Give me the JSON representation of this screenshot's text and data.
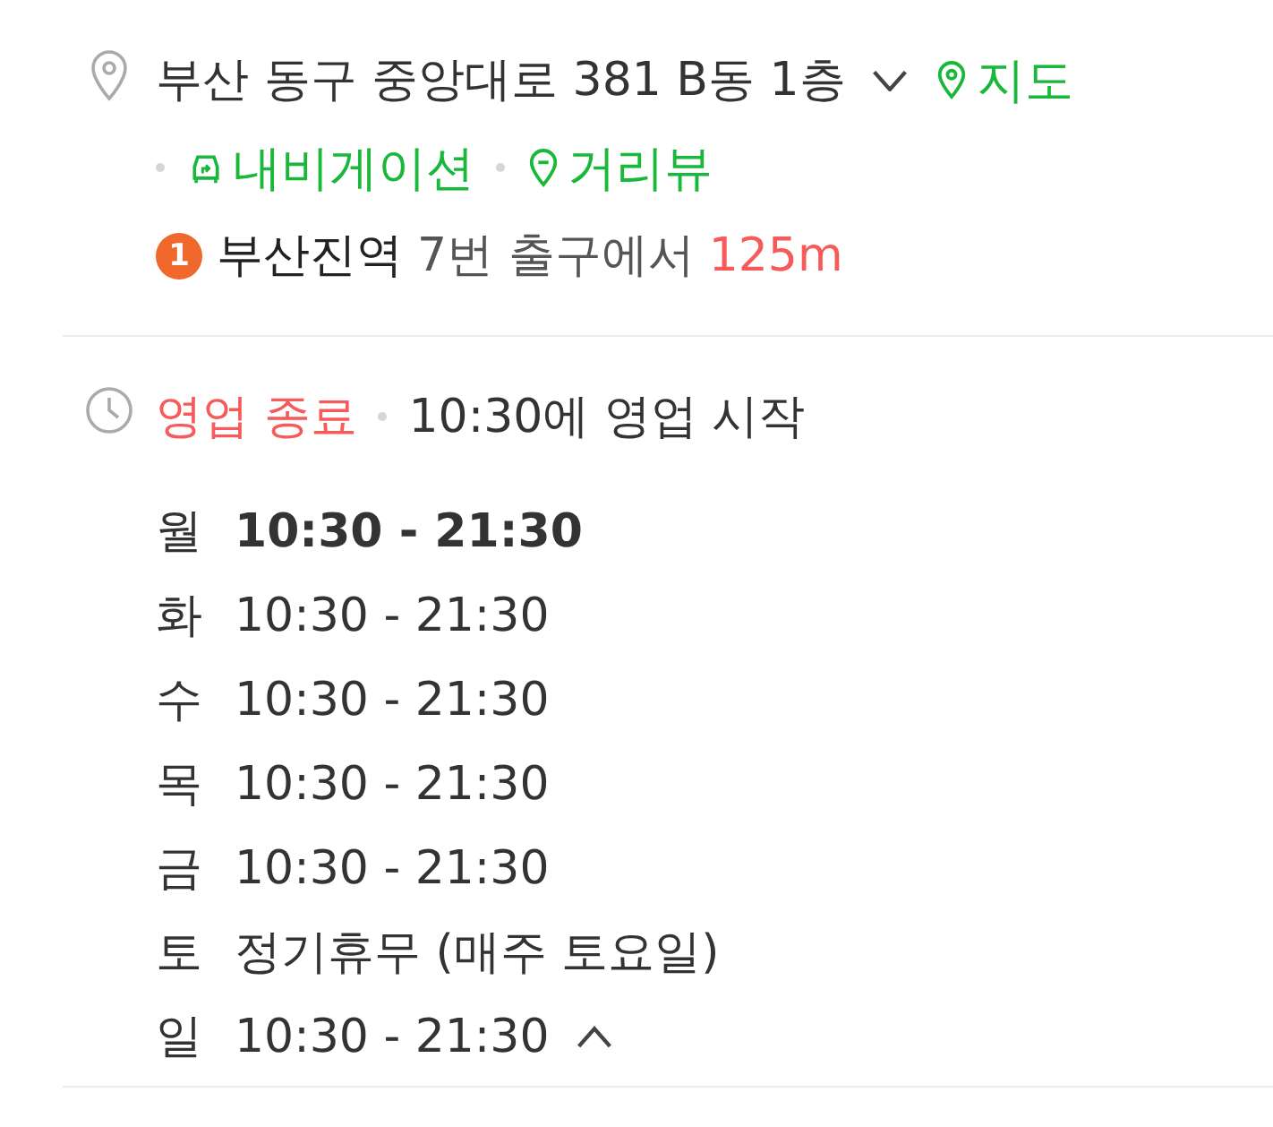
{
  "address": {
    "text": "부산 동구 중앙대로 381 B동 1층",
    "expanded": false
  },
  "links": [
    {
      "kind": "map",
      "label": "지도"
    },
    {
      "kind": "navigation",
      "label": "내비게이션"
    },
    {
      "kind": "streetview",
      "label": "거리뷰"
    }
  ],
  "subway": {
    "line": "1",
    "color": "#f0682c",
    "station": "부산진역",
    "exit": "7번 출구에서",
    "distance": "125m"
  },
  "hours": {
    "status": "영업 종료",
    "next": "10:30에 영업 시작",
    "expanded": true,
    "days": [
      {
        "day": "월",
        "time": "10:30 - 21:30",
        "today": true
      },
      {
        "day": "화",
        "time": "10:30 - 21:30",
        "today": false
      },
      {
        "day": "수",
        "time": "10:30 - 21:30",
        "today": false
      },
      {
        "day": "목",
        "time": "10:30 - 21:30",
        "today": false
      },
      {
        "day": "금",
        "time": "10:30 - 21:30",
        "today": false
      },
      {
        "day": "토",
        "time": "정기휴무 (매주 토요일)",
        "today": false
      },
      {
        "day": "일",
        "time": "10:30 - 21:30",
        "today": false
      }
    ]
  }
}
